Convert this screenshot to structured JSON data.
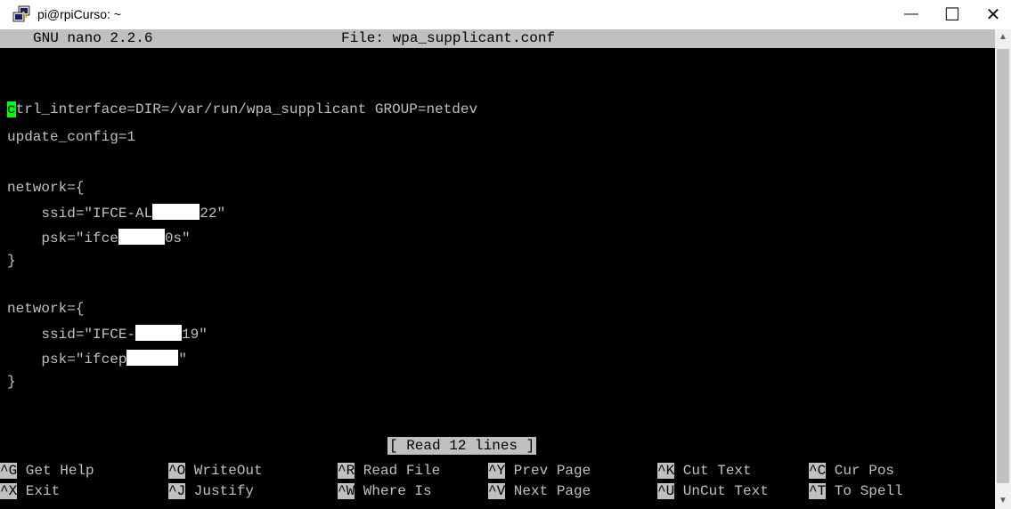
{
  "window": {
    "title": "pi@rpiCurso: ~",
    "minimize_label": "—",
    "maximize_label": "☐",
    "close_label": "✕",
    "app_icon": "putty-icon"
  },
  "nano": {
    "version": "GNU nano 2.2.6",
    "file_label": "File: wpa_supplicant.conf",
    "status_message": "[ Read 12 lines ]"
  },
  "file_lines": {
    "l1_cursor": "c",
    "l1_rest": "trl_interface=DIR=/var/run/wpa_supplicant GROUP=netdev",
    "l2": "update_config=1",
    "l4": "network={",
    "l5_pre": "    ssid=\"IFCE-AL",
    "l5_post": "22\"",
    "l6_pre": "    psk=\"ifce",
    "l6_post": "0s\"",
    "l7": "}",
    "l9": "network={",
    "l10_pre": "    ssid=\"IFCE-",
    "l10_post": "19\"",
    "l11_pre": "    psk=\"ifcep",
    "l11_post": "\"",
    "l12": "}"
  },
  "shortcuts": {
    "row1": [
      {
        "key": "^G",
        "label": " Get Help"
      },
      {
        "key": "^O",
        "label": " WriteOut"
      },
      {
        "key": "^R",
        "label": " Read File"
      },
      {
        "key": "^Y",
        "label": " Prev Page"
      },
      {
        "key": "^K",
        "label": " Cut Text"
      },
      {
        "key": "^C",
        "label": " Cur Pos"
      }
    ],
    "row2": [
      {
        "key": "^X",
        "label": " Exit"
      },
      {
        "key": "^J",
        "label": " Justify"
      },
      {
        "key": "^W",
        "label": " Where Is"
      },
      {
        "key": "^V",
        "label": " Next Page"
      },
      {
        "key": "^U",
        "label": " UnCut Text"
      },
      {
        "key": "^T",
        "label": " To Spell"
      }
    ]
  },
  "colors": {
    "terminal_bg": "#000000",
    "terminal_fg": "#c0c0c0",
    "bar_bg": "#c0c0c0",
    "cursor": "#00ff00",
    "redaction": "#ffffff"
  }
}
